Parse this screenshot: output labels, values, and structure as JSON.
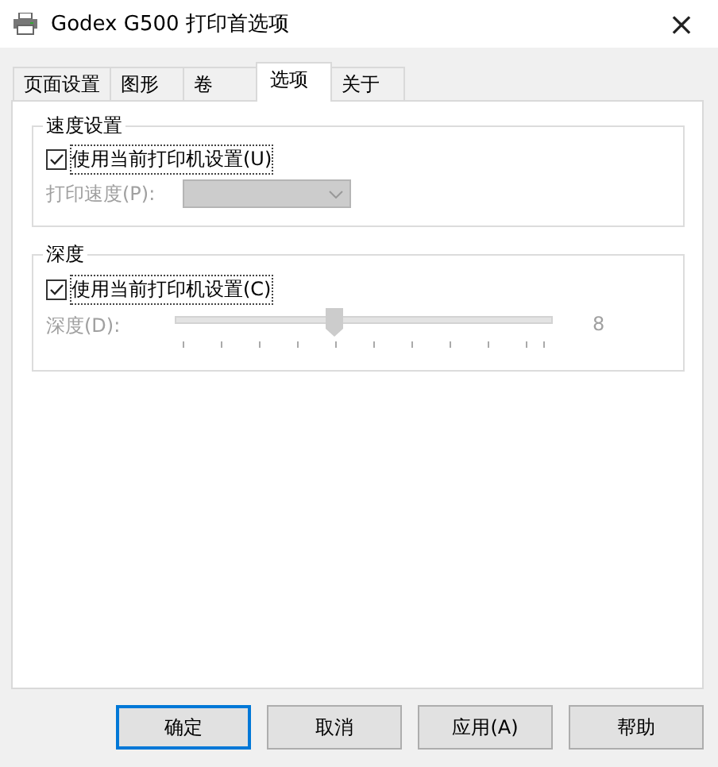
{
  "window": {
    "title": "Godex G500 打印首选项",
    "close": "×"
  },
  "tabs": [
    {
      "label": "页面设置",
      "selected": false
    },
    {
      "label": "图形",
      "selected": false
    },
    {
      "label": "卷",
      "selected": false
    },
    {
      "label": "选项",
      "selected": true
    },
    {
      "label": "关于",
      "selected": false
    }
  ],
  "speed_group": {
    "title": "速度设置",
    "checkbox": {
      "label": "使用当前打印机设置(U)",
      "checked": true
    },
    "speed": {
      "label": "打印速度(P):",
      "disabled": true
    }
  },
  "depth_group": {
    "title": "深度",
    "checkbox": {
      "label": "使用当前打印机设置(C)",
      "checked": true
    },
    "depth": {
      "label": "深度(D):",
      "disabled": true,
      "level": 0.42,
      "reading": "8"
    }
  },
  "buttons": [
    {
      "label": "确定",
      "default": true
    },
    {
      "label": "取消",
      "default": false
    },
    {
      "label": "应用(A)",
      "default": false
    },
    {
      "label": "帮助",
      "default": false
    }
  ]
}
